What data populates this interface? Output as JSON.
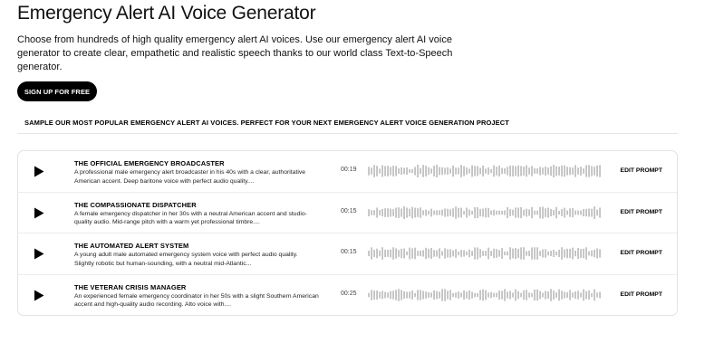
{
  "header": {
    "title": "Emergency Alert AI Voice Generator",
    "description": "Choose from hundreds of high quality emergency alert AI voices. Use our emergency alert AI voice generator to create clear, empathetic and realistic speech thanks to our world class Text-to-Speech generator.",
    "signup_label": "SIGN UP FOR FREE"
  },
  "section": {
    "heading": "SAMPLE OUR MOST POPULAR EMERGENCY ALERT AI VOICES. PERFECT FOR YOUR NEXT EMERGENCY ALERT VOICE GENERATION PROJECT"
  },
  "voices": [
    {
      "name": "THE OFFICIAL EMERGENCY BROADCASTER",
      "description": "A professional male emergency alert broadcaster in his 40s with a clear, authoritative American accent. Deep baritone voice with perfect audio quality....",
      "duration": "00:19",
      "action": "EDIT PROMPT"
    },
    {
      "name": "THE COMPASSIONATE DISPATCHER",
      "description": "A female emergency dispatcher in her 30s with a neutral American accent and studio-quality audio. Mid-range pitch with a warm yet professional timbre....",
      "duration": "00:15",
      "action": "EDIT PROMPT"
    },
    {
      "name": "THE AUTOMATED ALERT SYSTEM",
      "description": "A young adult male automated emergency system voice with perfect audio quality. Slightly robotic but human-sounding, with a neutral mid-Atlantic...",
      "duration": "00:15",
      "action": "EDIT PROMPT"
    },
    {
      "name": "THE VETERAN CRISIS MANAGER",
      "description": "An experienced female emergency coordinator in her 50s with a slight Southern American accent and high-quality audio recording. Alto voice with....",
      "duration": "00:25",
      "action": "EDIT PROMPT"
    }
  ],
  "icons": {
    "play": "play-icon",
    "waveform": "waveform-icon"
  },
  "colors": {
    "primary": "#000000",
    "waveform": "#9a9a9a",
    "border": "#e3e3e3"
  }
}
